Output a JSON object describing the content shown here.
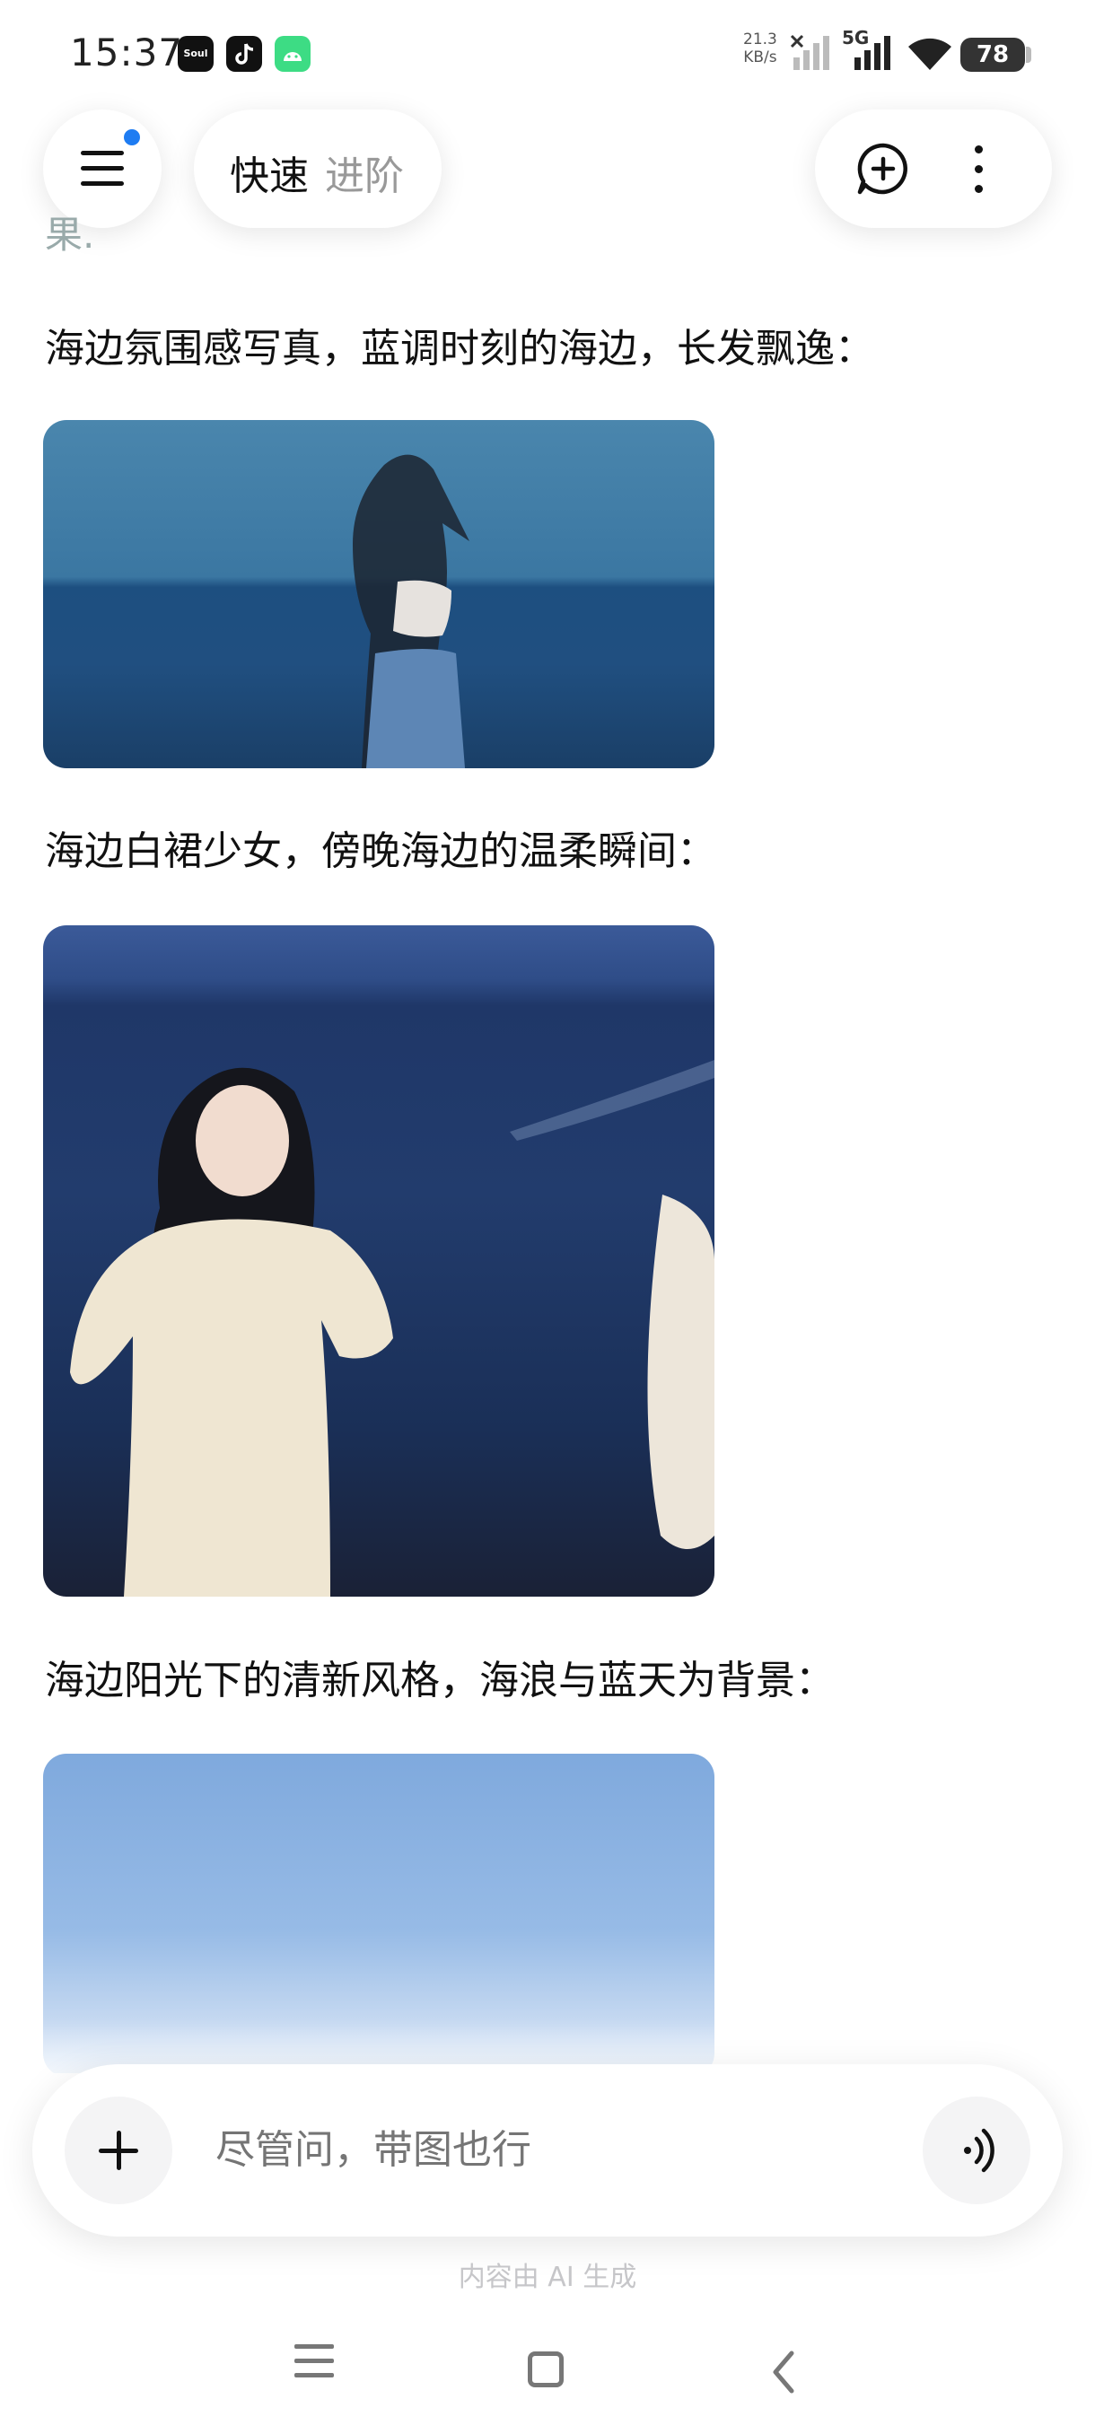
{
  "status_bar": {
    "time": "15:37",
    "net_speed_value": "21.3",
    "net_speed_unit": "KB/s",
    "network_type": "5G",
    "battery": "78",
    "app_icons": [
      "soul-app-icon",
      "tiktok-icon",
      "android-icon"
    ],
    "soul_label": "Soul"
  },
  "header": {
    "mode_fast": "快速",
    "mode_advanced": "进阶",
    "menu_has_notification": true,
    "notification_color": "#1e7cf2"
  },
  "chat": {
    "partial_text": "果.",
    "sections": [
      {
        "caption": "海边氛围感写真，蓝调时刻的海边，长发飘逸："
      },
      {
        "caption": "海边白裙少女，傍晚海边的温柔瞬间："
      },
      {
        "caption": "海边阳光下的清新风格，海浪与蓝天为背景："
      }
    ]
  },
  "composer": {
    "placeholder": "尽管问，带图也行",
    "add_icon": "plus-icon",
    "voice_icon": "voice-wave-icon"
  },
  "disclaimer": "内容由 AI 生成",
  "nav_bar": {
    "icons": [
      "menu-icon",
      "home-icon",
      "back-icon"
    ]
  }
}
